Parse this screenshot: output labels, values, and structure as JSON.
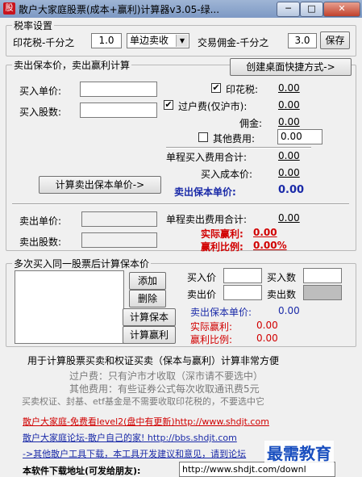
{
  "window": {
    "title": "散户大家庭股票(成本+赢利)计算器v3.05-绿...",
    "app_icon": "股",
    "min": "─",
    "max": "□",
    "close": "✕"
  },
  "rates": {
    "group_title": "税率设置",
    "stamp_label": "印花税-千分之",
    "stamp_value": "1.0",
    "stamp_mode": "单边卖收",
    "commission_label": "交易佣金-千分之",
    "commission_value": "3.0",
    "save_label": "保存"
  },
  "calc": {
    "group_title": "卖出保本价，卖出赢利计算",
    "shortcut_button": "创建桌面快捷方式->",
    "buy_price_label": "买入单价:",
    "buy_qty_label": "买入股数:",
    "stamp_tax_label": "印花税:",
    "stamp_tax_value": "0.00",
    "transfer_label": "过户费(仅沪市):",
    "transfer_value": "0.00",
    "commission_label": "佣金:",
    "commission_value": "0.00",
    "other_label": "其他费用:",
    "other_value": "0.00",
    "buy_fee_total_label": "单程买入费用合计:",
    "buy_fee_total_value": "0.00",
    "buy_cost_label": "买入成本价:",
    "buy_cost_value": "0.00",
    "breakeven_label": "卖出保本单价:",
    "breakeven_value": "0.00",
    "calc_button": "计算卖出保本单价->",
    "sell_price_label": "卖出单价:",
    "sell_qty_label": "卖出股数:",
    "sell_fee_total_label": "单程卖出费用合计:",
    "sell_fee_total_value": "0.00",
    "profit_label": "实际赢利:",
    "profit_value": "0.00",
    "ratio_label": "赢利比例:",
    "ratio_value": "0.00%"
  },
  "multi": {
    "group_title": "多次买入同一股票后计算保本价",
    "add_button": "添加",
    "delete_button": "删除",
    "calc_breakeven_button": "计算保本",
    "calc_profit_button": "计算赢利",
    "buy_price_label": "买入价",
    "buy_qty_label": "买入数",
    "sell_price_label": "卖出价",
    "sell_qty_label": "卖出数",
    "breakeven_label": "卖出保本单价:",
    "breakeven_value": "0.00",
    "profit_label": "实际赢利:",
    "profit_value": "0.00",
    "ratio_label": "赢利比例:",
    "ratio_value": "0.00"
  },
  "notes": {
    "headline": "用于计算股票买卖和权证买卖（保本与赢利）计算非常方便",
    "line1": "过户费：只有沪市才收取（深市请不要选中）",
    "line2": "其他费用：有些证券公式每次收取通讯费5元",
    "line3": "买卖权证、封基、etf基金是不需要收取印花税的，不要选中它"
  },
  "links": {
    "link1": "散户大家庭-免费看level2(盘中有更新)http://www.shdjt.com",
    "link2": "散户大家庭论坛-散户自己的家! http://bbs.shdjt.com",
    "link3": "->其他散户工具下载，本工具开发建议和意见，请到论坛",
    "download_label": "本软件下载地址(可发给朋友):",
    "download_url": "http://www.shdjt.com/downl"
  },
  "watermark": "最需教育"
}
